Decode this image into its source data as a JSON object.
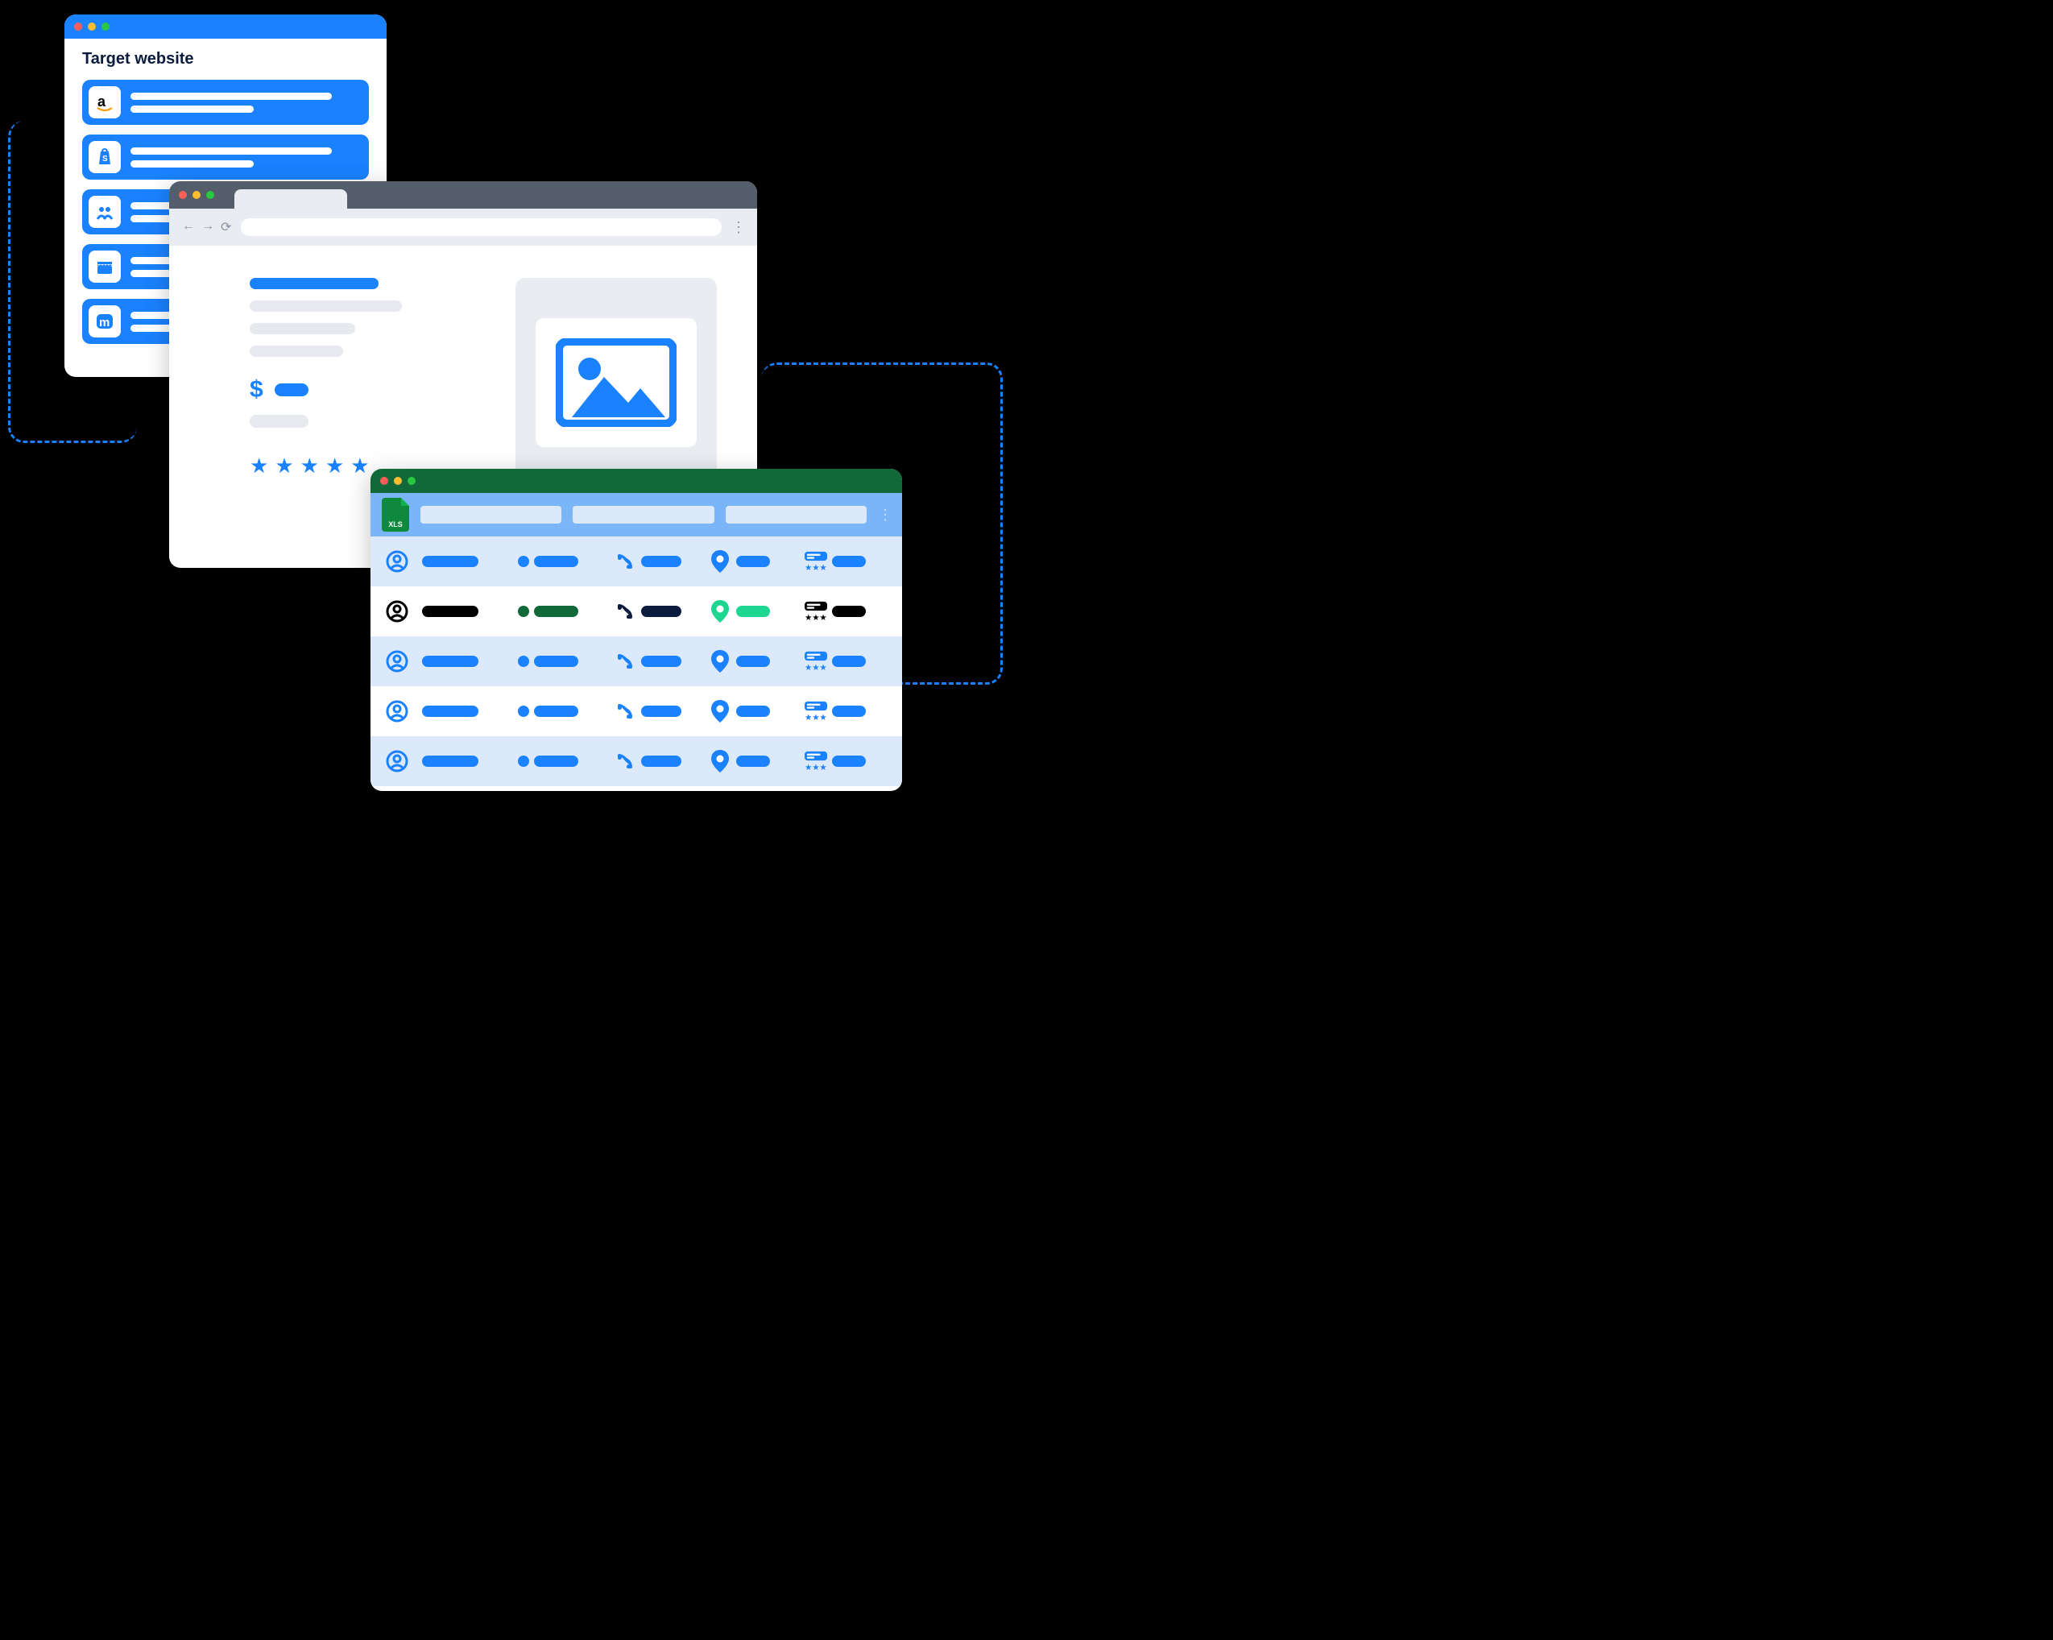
{
  "win1": {
    "title": "Target website",
    "sites": [
      {
        "name": "amazon"
      },
      {
        "name": "shopify"
      },
      {
        "name": "meetup"
      },
      {
        "name": "storefront"
      },
      {
        "name": "marketplace"
      }
    ]
  },
  "win2": {
    "price_symbol": "$",
    "star_count": 5
  },
  "win3": {
    "xls_label": "XLS",
    "header_cols": 3,
    "rows": [
      {
        "variant": "odd",
        "scheme": "blue"
      },
      {
        "variant": "even",
        "scheme": "mixed"
      },
      {
        "variant": "odd",
        "scheme": "blue"
      },
      {
        "variant": "even",
        "scheme": "blue"
      },
      {
        "variant": "odd",
        "scheme": "blue"
      }
    ]
  }
}
